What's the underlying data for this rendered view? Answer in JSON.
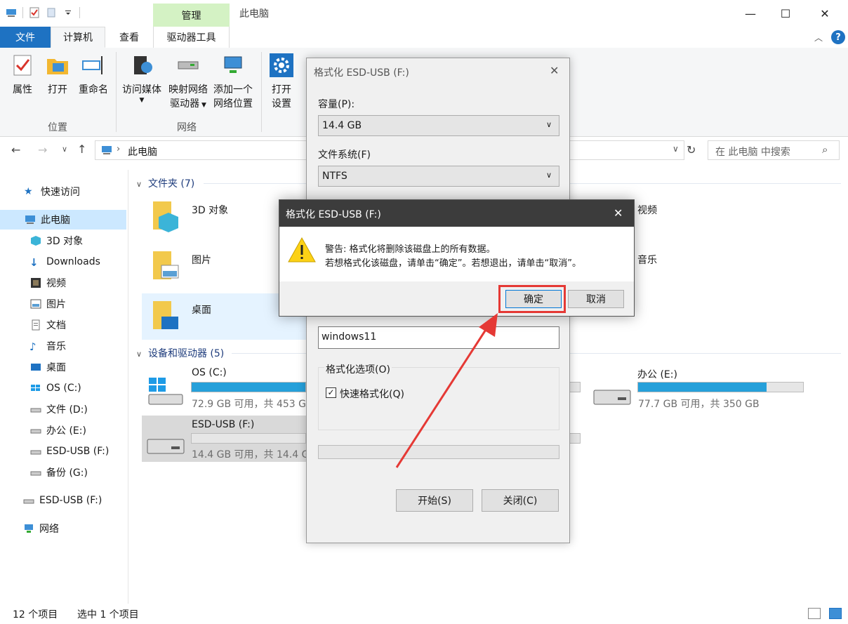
{
  "window": {
    "title": "此电脑",
    "manage_tab": "管理",
    "minimize": "—",
    "maximize": "☐",
    "close": "✕",
    "help": "?"
  },
  "ribbon_tabs": [
    "文件",
    "计算机",
    "查看",
    "驱动器工具"
  ],
  "ribbon": {
    "location_group": {
      "label": "位置",
      "buttons": [
        "属性",
        "打开",
        "重命名"
      ]
    },
    "network_group": {
      "label": "网络",
      "access_media": [
        "访问媒体"
      ],
      "map_drive": [
        "映射网络",
        "驱动器"
      ],
      "add_location": [
        "添加一个",
        "网络位置"
      ]
    },
    "system_group": {
      "open_settings": [
        "打开",
        "设置"
      ]
    }
  },
  "address": {
    "path": "此电脑",
    "search_placeholder": "在 此电脑 中搜索"
  },
  "nav": {
    "items": [
      "快速访问",
      "此电脑",
      "3D 对象",
      "Downloads",
      "视频",
      "图片",
      "文档",
      "音乐",
      "桌面",
      "OS (C:)",
      "文件 (D:)",
      "办公 (E:)",
      "ESD-USB (F:)",
      "备份 (G:)",
      "ESD-USB (F:)",
      "网络"
    ]
  },
  "content": {
    "folders_header": "文件夹 (7)",
    "folders": [
      "3D 对象",
      "视频",
      "图片",
      "音乐",
      "桌面"
    ],
    "devices_header": "设备和驱动器 (5)",
    "drives": [
      {
        "name": "OS (C:)",
        "info": "72.9 GB 可用，共 453 G",
        "used": 0.84
      },
      {
        "name": "办公 (E:)",
        "info": "77.7 GB 可用，共 350 GB",
        "used": 0.78
      },
      {
        "name": "ESD-USB (F:)",
        "info": "14.4 GB 可用，共 14.4 G",
        "used": 0.0
      }
    ]
  },
  "status": {
    "count": "12 个项目",
    "selected": "选中 1 个项目"
  },
  "format_dialog": {
    "title": "格式化 ESD-USB (F:)",
    "capacity_label": "容量(P):",
    "capacity_value": "14.4 GB",
    "fs_label": "文件系统(F)",
    "fs_value": "NTFS",
    "volume_label_value": "windows11",
    "options_label": "格式化选项(O)",
    "quick_format": "快速格式化(Q)",
    "quick_format_checked": true,
    "start_button": "开始(S)",
    "close_button": "关闭(C)"
  },
  "warning_dialog": {
    "title": "格式化 ESD-USB (F:)",
    "line1": "警告: 格式化将删除该磁盘上的所有数据。",
    "line2": "若想格式化该磁盘，请单击“确定”。若想退出，请单击“取消”。",
    "ok_button": "确定",
    "cancel_button": "取消",
    "highlight_color": "#e53935"
  },
  "colors": {
    "accent": "#1e72c2",
    "manage_tab": "#d4f2c4",
    "drive_bar": "#26a0da"
  }
}
